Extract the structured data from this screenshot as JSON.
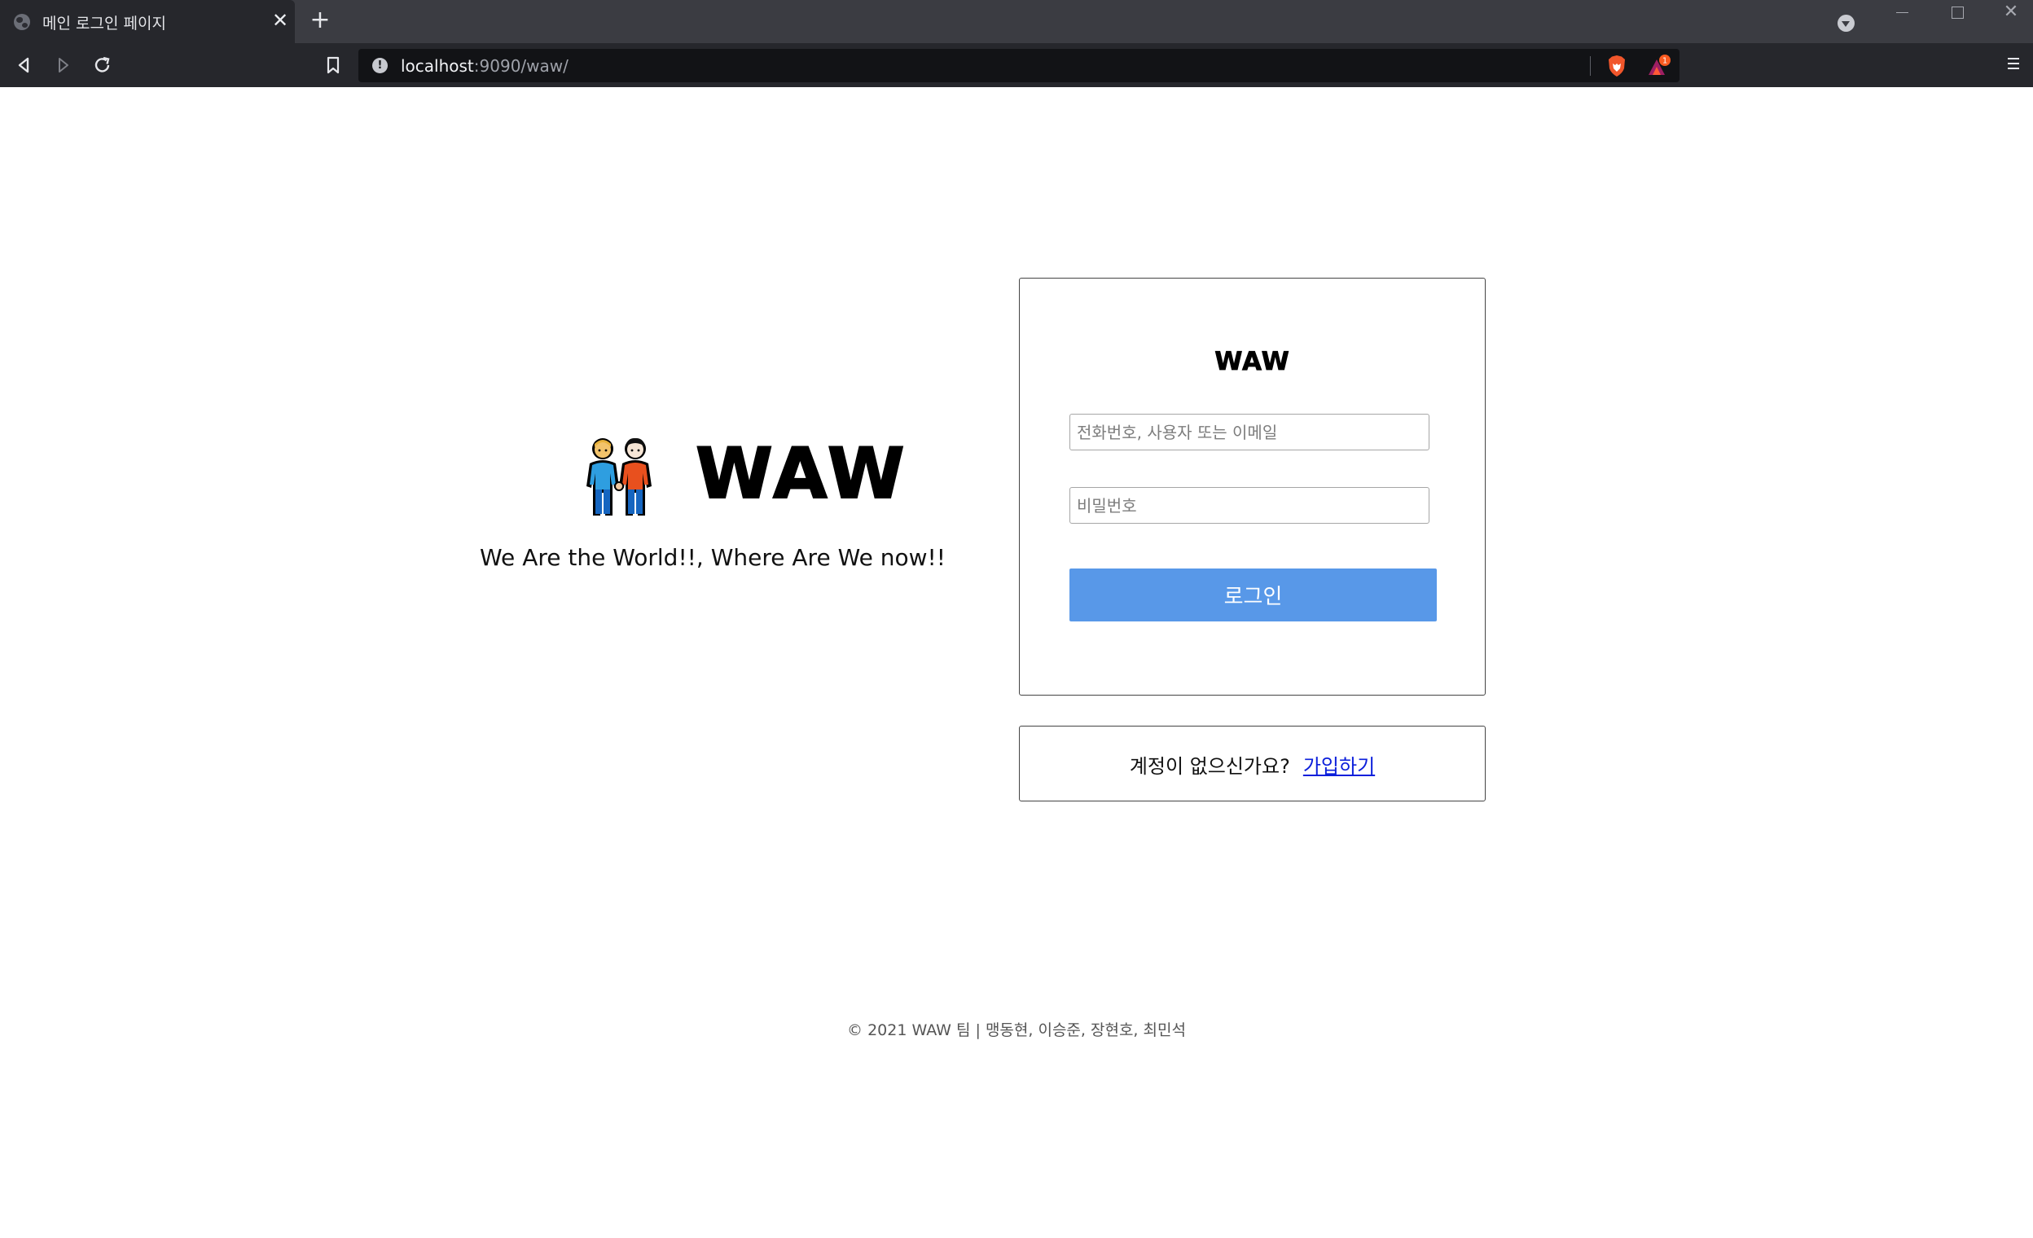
{
  "browser": {
    "tab_title": "메인 로그인 페이지",
    "tab_close": "✕",
    "new_tab": "+",
    "url_host": "localhost",
    "url_path": ":9090/waw/",
    "window_close": "✕",
    "rewards_badge": "1"
  },
  "hero": {
    "logo": "WAW",
    "tagline": "We Are the World!!, Where Are We now!!"
  },
  "login": {
    "logo": "WAW",
    "id_placeholder": "전화번호, 사용자 또는 이메일",
    "password_placeholder": "비밀번호",
    "submit_label": "로그인"
  },
  "signup": {
    "prompt": "계정이 없으신가요?",
    "link_label": "가입하기"
  },
  "footer": {
    "text": "© 2021 WAW 팀 | 맹동현, 이승준, 장현호, 최민석"
  },
  "colors": {
    "primary_button": "#5898e8",
    "link": "#0a1edb",
    "chrome_dark": "#26272c"
  }
}
